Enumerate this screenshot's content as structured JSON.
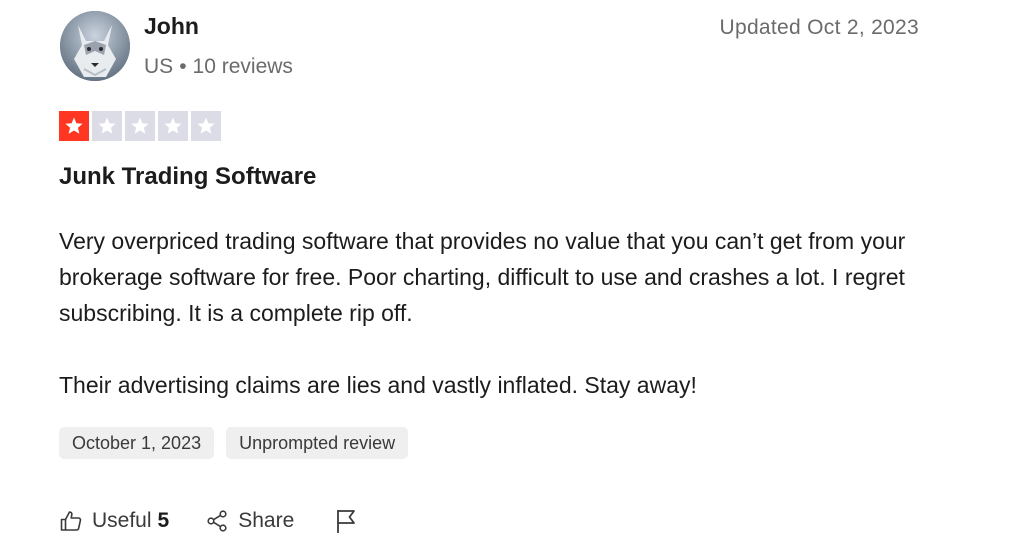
{
  "reviewer": {
    "name": "John",
    "country": "US",
    "separator": "•",
    "reviews_count": "10 reviews"
  },
  "updated_label": "Updated Oct 2, 2023",
  "rating": {
    "value": 1,
    "max": 5,
    "filled_color": "#ff3722",
    "empty_color": "#dcdce6"
  },
  "review": {
    "title": "Junk Trading Software",
    "paragraphs": [
      "Very overpriced trading software that provides no value that you can’t get from your brokerage software for free. Poor charting, difficult to use and crashes a lot. I regret subscribing. It is a complete rip off.",
      "Their advertising claims are lies and vastly inflated. Stay away!"
    ]
  },
  "tags": {
    "date": "October 1, 2023",
    "type": "Unprompted review"
  },
  "actions": {
    "useful_label": "Useful",
    "useful_count": "5",
    "share_label": "Share",
    "useful_icon": "thumbs-up-icon",
    "share_icon": "share-icon",
    "flag_icon": "flag-icon"
  }
}
